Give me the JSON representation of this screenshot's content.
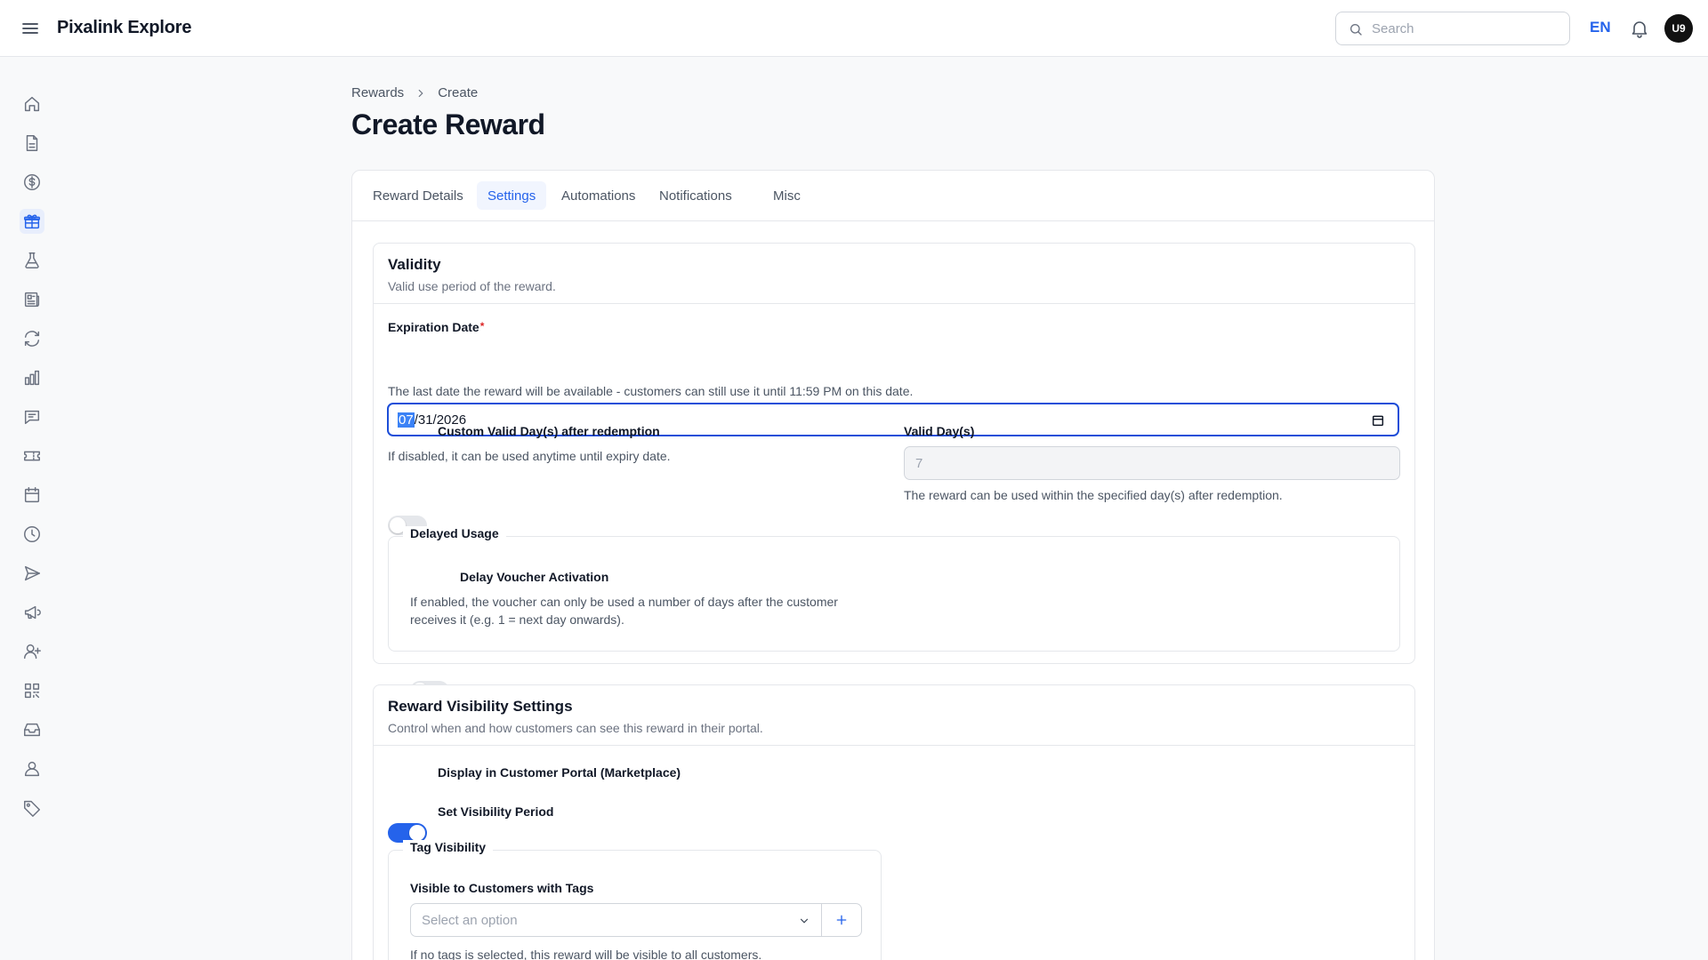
{
  "app": {
    "title": "Pixalink Explore"
  },
  "header": {
    "search_placeholder": "Search",
    "language": "EN",
    "avatar_initials": "U9"
  },
  "sidebar": {
    "items": [
      {
        "icon": "home-icon"
      },
      {
        "icon": "document-icon"
      },
      {
        "icon": "dollar-icon"
      },
      {
        "icon": "gift-icon",
        "active": true
      },
      {
        "icon": "flask-icon"
      },
      {
        "icon": "newspaper-icon"
      },
      {
        "icon": "refresh-icon"
      },
      {
        "icon": "bar-chart-icon"
      },
      {
        "icon": "message-icon"
      },
      {
        "icon": "ticket-icon"
      },
      {
        "icon": "calendar-icon"
      },
      {
        "icon": "clock-icon"
      },
      {
        "icon": "send-icon"
      },
      {
        "icon": "megaphone-icon"
      },
      {
        "icon": "user-plus-icon"
      },
      {
        "icon": "qr-code-icon"
      },
      {
        "icon": "inbox-icon"
      },
      {
        "icon": "user-icon"
      },
      {
        "icon": "tag-icon"
      }
    ]
  },
  "breadcrumb": {
    "parent": "Rewards",
    "current": "Create"
  },
  "page": {
    "title": "Create Reward"
  },
  "tabs": [
    {
      "label": "Reward Details"
    },
    {
      "label": "Settings",
      "active": true
    },
    {
      "label": "Automations"
    },
    {
      "label": "Notifications"
    },
    {
      "label": "Misc"
    }
  ],
  "validity": {
    "title": "Validity",
    "description": "Valid use period of the reward.",
    "expiration_label": "Expiration Date",
    "required_mark": "*",
    "expiration_month": "07",
    "expiration_rest": "/31/2026",
    "expiration_help": "The last date the reward will be available - customers can still use it until 11:59 PM on this date.",
    "custom_days_label": "Custom Valid Day(s) after redemption",
    "custom_days_help": "If disabled, it can be used anytime until expiry date.",
    "custom_days_enabled": false,
    "valid_days_label": "Valid Day(s)",
    "valid_days_value": "7",
    "valid_days_help": "The reward can be used within the specified day(s) after redemption.",
    "delayed_legend": "Delayed Usage",
    "delay_label": "Delay Voucher Activation",
    "delay_enabled": false,
    "delay_help_1": "If enabled, the voucher can only be used a number of days after the customer",
    "delay_help_2": "receives it (e.g. 1 = next day onwards)."
  },
  "visibility": {
    "title": "Reward Visibility Settings",
    "description": "Control when and how customers can see this reward in their portal.",
    "display_portal_label": "Display in Customer Portal (Marketplace)",
    "display_portal_enabled": true,
    "visibility_period_label": "Set Visibility Period",
    "visibility_period_enabled": false,
    "tag_legend": "Tag Visibility",
    "tags_label": "Visible to Customers with Tags",
    "tags_placeholder": "Select an option",
    "tags_help": "If no tags is selected, this reward will be visible to all customers."
  },
  "colors": {
    "accent": "#2563eb",
    "border": "#e5e7eb",
    "muted": "#6b7280"
  }
}
